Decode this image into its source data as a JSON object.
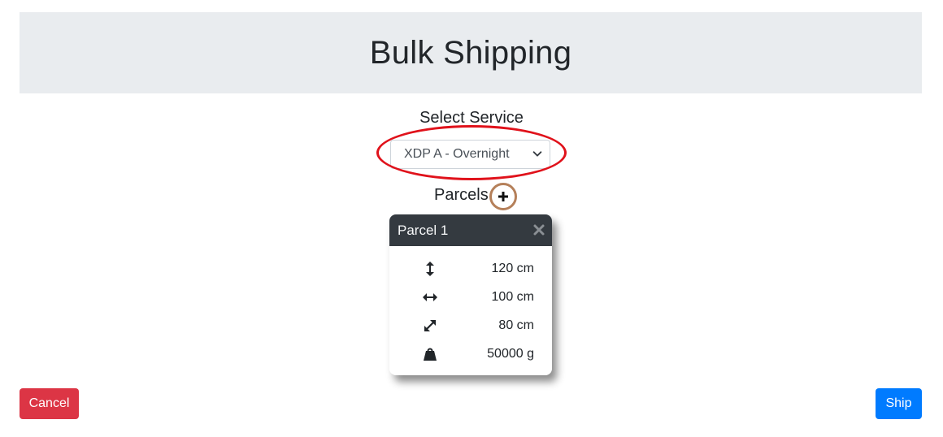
{
  "header": {
    "title": "Bulk Shipping"
  },
  "service": {
    "label": "Select Service",
    "selected": "XDP A - Overnight"
  },
  "parcels": {
    "label": "Parcels",
    "add_icon": "plus-icon",
    "items": [
      {
        "title": "Parcel 1",
        "close_icon": "close-icon",
        "height": "120 cm",
        "width": "100 cm",
        "depth": "80 cm",
        "weight": "50000 g"
      }
    ]
  },
  "actions": {
    "cancel_label": "Cancel",
    "ship_label": "Ship"
  },
  "colors": {
    "header_bg": "#e9ecef",
    "cancel": "#dc3545",
    "ship": "#007bff",
    "card_header": "#343a40",
    "highlight_red": "#e0121b",
    "highlight_brown": "#b5805a"
  }
}
